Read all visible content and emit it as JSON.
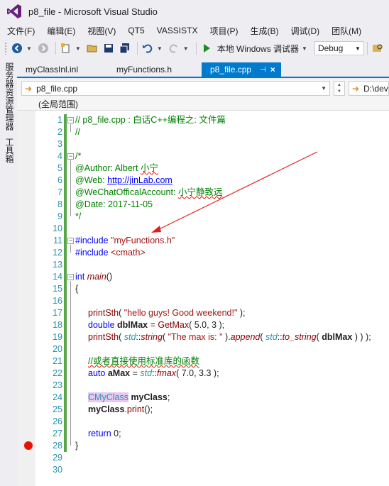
{
  "window": {
    "title": "p8_file - Microsoft Visual Studio"
  },
  "menu": [
    "文件(F)",
    "编辑(E)",
    "视图(V)",
    "QT5",
    "VASSISTX",
    "项目(P)",
    "生成(B)",
    "调试(D)",
    "团队(M)"
  ],
  "toolbar": {
    "debugger": "本地 Windows 调试器",
    "config": "Debug"
  },
  "side": {
    "server_explorer": "服务器资源管理器",
    "toolbox": "工具箱"
  },
  "tabs": [
    {
      "label": "myClassInl.inl"
    },
    {
      "label": "myFunctions.h"
    },
    {
      "label": "p8_file.cpp",
      "pin": "⊣",
      "close": "×"
    }
  ],
  "nav": {
    "file": "p8_file.cpp",
    "path": "D:\\dev\\"
  },
  "scope": "(全局范围)",
  "line_numbers": [
    "1",
    "2",
    "3",
    "4",
    "5",
    "6",
    "7",
    "8",
    "9",
    "10",
    "11",
    "12",
    "13",
    "14",
    "15",
    "16",
    "17",
    "18",
    "19",
    "20",
    "21",
    "22",
    "23",
    "24",
    "25",
    "26",
    "27",
    "28",
    "29",
    "30"
  ],
  "code": {
    "l1": "// p8_file.cpp : 白话C++编程之: 文件篇",
    "l2": "//",
    "l4": "/*",
    "l5a": "@Author: Albert ",
    "l5b": "小宁",
    "l6a": "@Web: ",
    "l6b": "http://jinLab.com",
    "l7a": "@WeChatOfficalAccount: ",
    "l7b": "小宁静致远",
    "l8": "@Date: 2017-11-05",
    "l9": "*/",
    "l11a": "#include",
    "l11b": " \"myFunctions.h\"",
    "l12a": "#include",
    "l12b": " <cmath>",
    "l14a": "int",
    "l14b": "main",
    "l14c": "()",
    "l15": "{",
    "l17a": "printSth",
    "l17b": "( ",
    "l17c": "\"hello guys! Good weekend!\"",
    "l17d": " );",
    "l18a": "double",
    "l18b": "dblMax",
    "l18c": " = ",
    "l18d": "GetMax",
    "l18e": "( 5.0, 3 );",
    "l19a": "printSth",
    "l19b": "( ",
    "l19c": "std",
    "l19d": "::",
    "l19e": "string",
    "l19f": "( ",
    "l19g": "\"The max is: \"",
    "l19h": " ).",
    "l19i": "append",
    "l19j": "( ",
    "l19k": "std",
    "l19l": "::",
    "l19m": "to_string",
    "l19n": "( ",
    "l19o": "dblMax",
    "l19p": " ) ) );",
    "l21": "//或者直接使用标准库的函数",
    "l22a": "auto",
    "l22b": "aMax",
    "l22c": " = ",
    "l22d": "std",
    "l22e": "::",
    "l22f": "fmax",
    "l22g": "( 7.0, 3.3 );",
    "l24a": "CMyClass",
    "l24b": "myClass",
    "l24c": ";",
    "l25a": "myClass",
    "l25b": ".",
    "l25c": "print",
    "l25d": "();",
    "l27a": "return",
    "l27b": " 0;",
    "l28": "}"
  },
  "colors": {
    "accent": "#007acc",
    "changed": "#57a64a",
    "breakpoint": "#e51400",
    "annotation_arrow": "#e02020"
  }
}
